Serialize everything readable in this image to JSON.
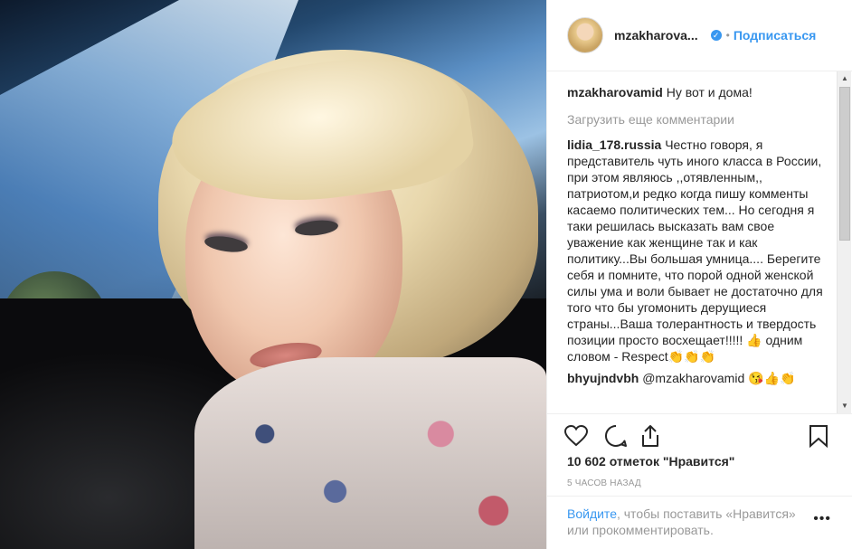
{
  "header": {
    "username": "mzakharova...",
    "verified_glyph": "✓",
    "separator": "•",
    "follow_label": "Подписаться"
  },
  "comments": {
    "caption": {
      "user": "mzakharovamid",
      "text": "Ну вот и дома!"
    },
    "load_more": "Загрузить еще комментарии",
    "items": [
      {
        "user": "lidia_178.russia",
        "text": "Честно говоря, я представитель чуть иного класса в России, при этом являюсь ,,отявленным,, патриотом,и редко когда пишу комменты касаемо политических тем... Но сегодня я таки решилась высказать вам свое уважение как женщине так и как политику...Вы большая умница.... Берегите себя и помните, что порой одной женской силы ума и воли бывает не достаточно для того что бы угомонить дерущиеся страны...Ваша толерантность и твердость позиции просто восхещает!!!!! 👍 одним словом - Respect👏👏👏"
      },
      {
        "user": "bhyujndvbh",
        "text": "@mzakharovamid 😘👍👏"
      }
    ]
  },
  "actions": {
    "like": "heart-outline",
    "comment": "speech-bubble",
    "share": "share-arrow",
    "save": "bookmark"
  },
  "likes": "10 602 отметок \"Нравится\"",
  "time": "5 ЧАСОВ НАЗАД",
  "footer": {
    "login_link": "Войдите",
    "rest": ", чтобы поставить «Нравится» или прокомментировать.",
    "more": "•••"
  },
  "colors": {
    "accent": "#3897f0",
    "text": "#262626",
    "muted": "#999999",
    "border": "#efefef"
  }
}
